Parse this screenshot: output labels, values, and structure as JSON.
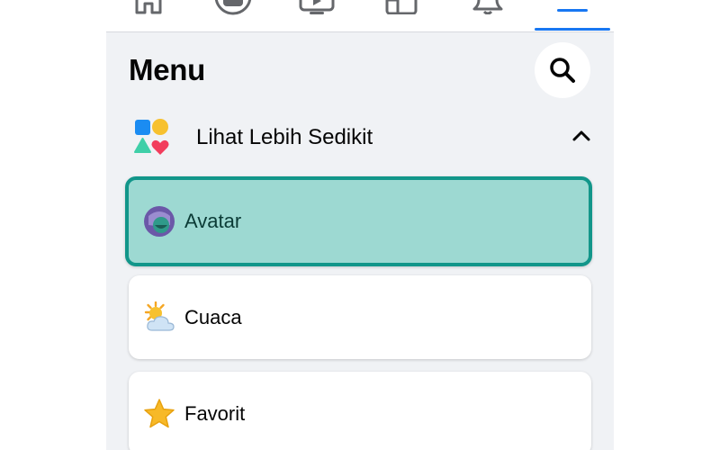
{
  "nav": {
    "tabs": [
      {
        "icon": "home-icon",
        "active": false
      },
      {
        "icon": "groups-icon",
        "active": false
      },
      {
        "icon": "watch-video-icon",
        "active": false
      },
      {
        "icon": "marketplace-icon",
        "active": false
      },
      {
        "icon": "notifications-bell-icon",
        "active": false
      },
      {
        "icon": "menu-hamburger-icon",
        "active": true
      }
    ],
    "accent_color": "#1877f2"
  },
  "header": {
    "title": "Menu",
    "search_icon": "search-icon"
  },
  "shortcuts_toggle": {
    "label": "Lihat Lebih Sedikit",
    "icon": "shapes-icon",
    "chevron": "chevron-up-icon"
  },
  "items": [
    {
      "label": "Avatar",
      "icon": "avatar-icon",
      "highlighted": true,
      "highlight_color": "#9dd9d2",
      "highlight_border": "#12968a"
    },
    {
      "label": "Cuaca",
      "icon": "weather-sun-cloud-icon",
      "highlighted": false
    },
    {
      "label": "Favorit",
      "icon": "star-icon",
      "highlighted": false
    }
  ]
}
